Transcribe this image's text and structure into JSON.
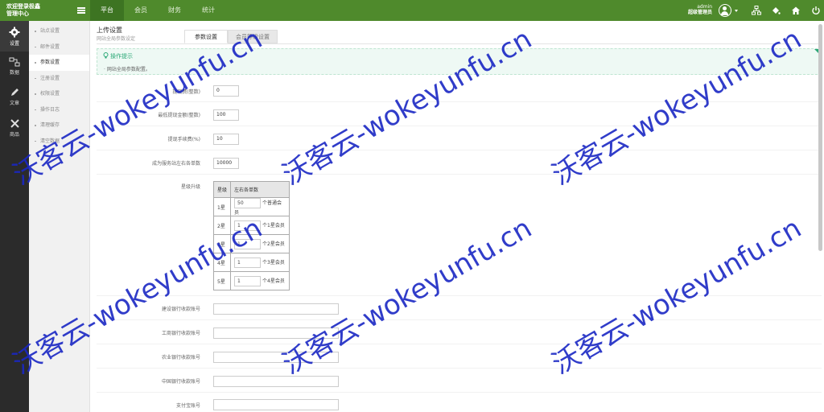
{
  "header": {
    "brand_line1": "欢迎登录极鑫",
    "brand_line2": "管理中心",
    "nav": [
      {
        "label": "平台",
        "active": true
      },
      {
        "label": "会员",
        "active": false
      },
      {
        "label": "财务",
        "active": false
      },
      {
        "label": "统计",
        "active": false
      }
    ],
    "user_name": "admin",
    "user_role": "超级管理员",
    "icons": [
      "menu-icon",
      "avatar-icon",
      "sitemap-icon",
      "paint-bucket-icon",
      "home-icon",
      "power-icon"
    ]
  },
  "sidebar_main": [
    {
      "label": "设置",
      "icon": "gear-icon",
      "active": true
    },
    {
      "label": "数据",
      "icon": "data-icon",
      "active": false
    },
    {
      "label": "文章",
      "icon": "pen-icon",
      "active": false
    },
    {
      "label": "商品",
      "icon": "tools-icon",
      "active": false
    }
  ],
  "sidebar_sub": [
    {
      "label": "站点设置",
      "active": false
    },
    {
      "label": "邮件设置",
      "active": false
    },
    {
      "label": "参数设置",
      "active": true
    },
    {
      "label": "注册设置",
      "active": false
    },
    {
      "label": "权限设置",
      "active": false
    },
    {
      "label": "操作日志",
      "active": false
    },
    {
      "label": "清理缓存",
      "active": false
    },
    {
      "label": "清空数据",
      "active": false
    }
  ],
  "page": {
    "title": "上传设置",
    "subtitle": "网站全局参数设定",
    "tabs": [
      "参数设置",
      "会员等级设置"
    ],
    "tip_title": "操作提示",
    "tip_body": "网站全局参数配置。"
  },
  "form": {
    "fields": [
      {
        "label": "提现费(整数)",
        "value": "0"
      },
      {
        "label": "最低提现金额(整数)",
        "value": "100"
      },
      {
        "label": "提现手续费(%)",
        "value": "10"
      },
      {
        "label": "成为服务站左右各单数",
        "value": "10000"
      }
    ],
    "level_label": "星级升级",
    "level_table": {
      "headers": [
        "星级",
        "左右各单数"
      ],
      "rows": [
        {
          "level": "1星",
          "value": "50",
          "unit": "个普通会员"
        },
        {
          "level": "2星",
          "value": "1",
          "unit": "个1星会员"
        },
        {
          "level": "3星",
          "value": "1",
          "unit": "个2星会员"
        },
        {
          "level": "4星",
          "value": "1",
          "unit": "个3星会员"
        },
        {
          "level": "5星",
          "value": "1",
          "unit": "个4星会员"
        }
      ]
    },
    "bank_fields": [
      {
        "label": "建设银行收款账号",
        "value": ""
      },
      {
        "label": "工商银行收款账号",
        "value": ""
      },
      {
        "label": "农业银行收款账号",
        "value": ""
      },
      {
        "label": "中国银行收款账号",
        "value": ""
      },
      {
        "label": "支付宝账号",
        "value": ""
      }
    ]
  },
  "watermark": "沃客云-wokeyunfu.cn"
}
